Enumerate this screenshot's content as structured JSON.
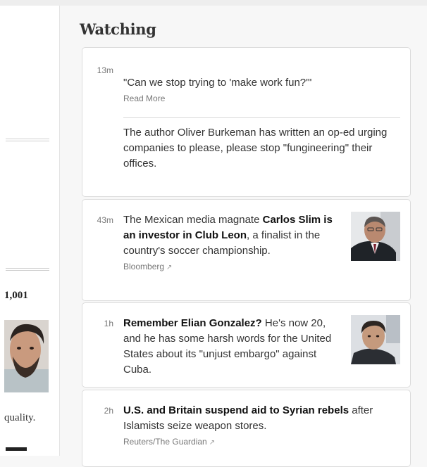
{
  "left": {
    "stat": "1,001",
    "caption": "quality."
  },
  "watching": {
    "title": "Watching",
    "items": [
      {
        "time": "13m",
        "headline": "\"Can we stop trying to 'make work fun?'\"",
        "source": "Read More",
        "body": "The author Oliver Burkeman has written an op-ed urging companies to please, please stop \"fungineering\" their offices."
      },
      {
        "time": "43m",
        "pre": "The Mexican media magnate ",
        "bold": "Carlos Slim is an investor in Club Leon",
        "post": ", a finalist in the country's soccer championship.",
        "source": "Bloomberg"
      },
      {
        "time": "1h",
        "bold": "Remember Elian Gonzalez?",
        "post": " He's now 20, and he has some harsh words for the United States about its \"unjust embargo\" against Cuba."
      },
      {
        "time": "2h",
        "bold": "U.S. and Britain suspend aid to Syrian rebels",
        "post": " after Islamists seize weapon stores.",
        "source": "Reuters/The Guardian"
      }
    ]
  },
  "icons": {
    "external": "external-link-icon"
  }
}
